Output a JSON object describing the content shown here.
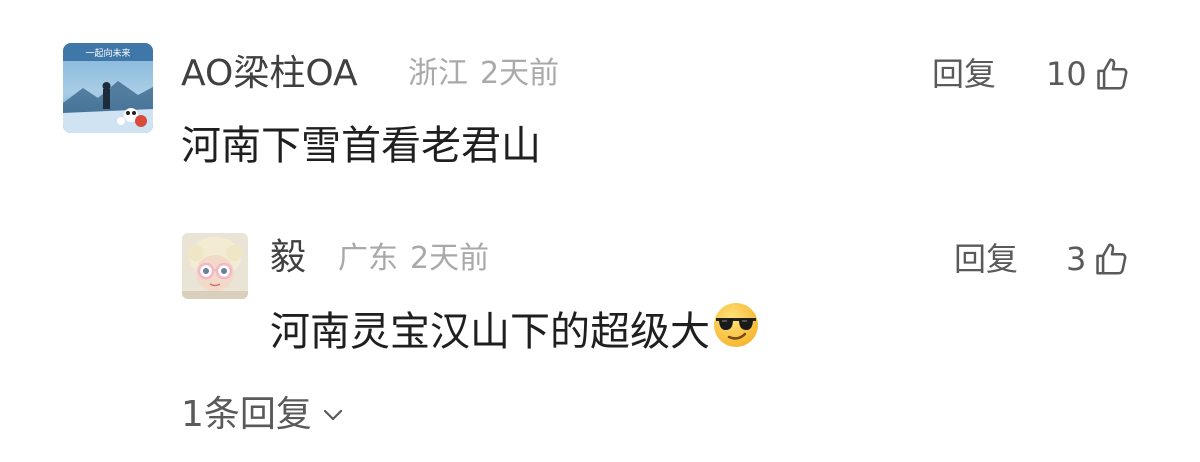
{
  "comment": {
    "username": "AO梁柱OA",
    "location": "浙江",
    "time": "2天前",
    "reply_label": "回复",
    "like_count": "10",
    "content": "河南下雪首看老君山",
    "avatar_text": "一起向未来"
  },
  "reply": {
    "username": "毅",
    "location": "广东",
    "time": "2天前",
    "reply_label": "回复",
    "like_count": "3",
    "content": "河南灵宝汉山下的超级大",
    "emoji": "sunglasses-emoji"
  },
  "more_replies": {
    "label": "1条回复",
    "icon": "chevron-down-icon"
  },
  "colors": {
    "username": "#404040",
    "meta": "#a9a9a9",
    "action": "#5a5a5a",
    "content": "#1f1f1f"
  }
}
